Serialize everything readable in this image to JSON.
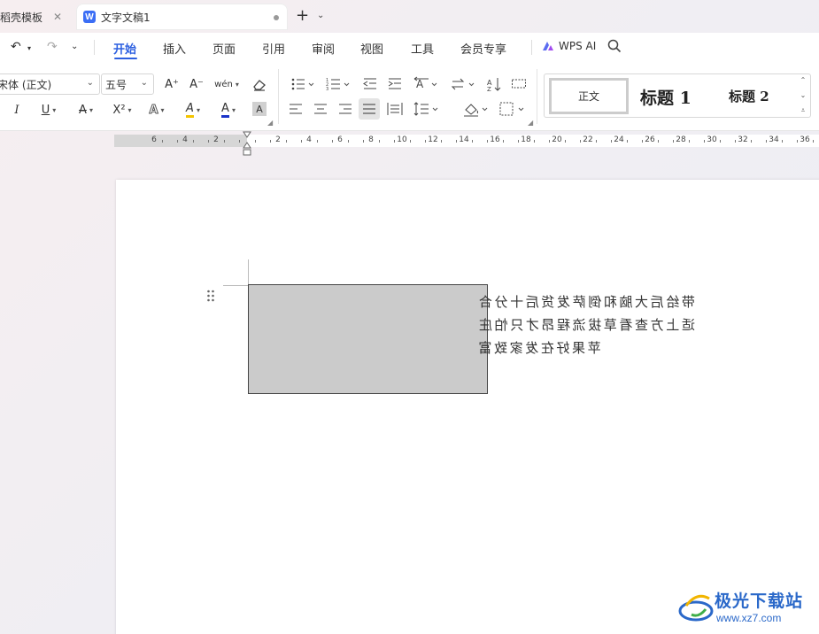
{
  "tabs": {
    "template_label": "稻壳模板",
    "doc_label": "文字文稿1",
    "doc_logo_letter": "W"
  },
  "menu": {
    "items": [
      "开始",
      "插入",
      "页面",
      "引用",
      "审阅",
      "视图",
      "工具",
      "会员专享"
    ],
    "wps_ai": "WPS AI",
    "active": "开始"
  },
  "ribbon": {
    "font_name": "宋体 (正文)",
    "font_size": "五号",
    "buttons": {
      "grow": "A⁺",
      "shrink": "A⁻",
      "phonetic": "wén",
      "italic": "I",
      "underline": "U",
      "strike": "A",
      "superscript": "X²",
      "text_effect": "A",
      "highlight": "A",
      "font_color": "A",
      "char_shading": "A"
    },
    "styles": {
      "normal": "正文",
      "heading1": "标题 1",
      "heading2": "标题 2"
    }
  },
  "ruler": {
    "left_numbers": [
      "6",
      "4",
      "2"
    ],
    "right_numbers": [
      "2",
      "4",
      "6",
      "8",
      "10",
      "12",
      "14",
      "16",
      "18",
      "20",
      "22",
      "24",
      "26",
      "28",
      "30",
      "32",
      "34",
      "36"
    ]
  },
  "document": {
    "textbox_lines": [
      "带给后大脑和倒萨发货后十分合",
      "适上方查看草拔流程昂才只怕庄",
      "苹果好在发家致富"
    ],
    "textbox_fill": "#cbcbcb",
    "text_mirrored": true
  },
  "watermark": {
    "title": "极光下载站",
    "url": "www.xz7.com"
  },
  "colors": {
    "accent": "#2c5fe0",
    "font_color_bar": "#1a33c8",
    "highlight_bar": "#f4c400"
  }
}
